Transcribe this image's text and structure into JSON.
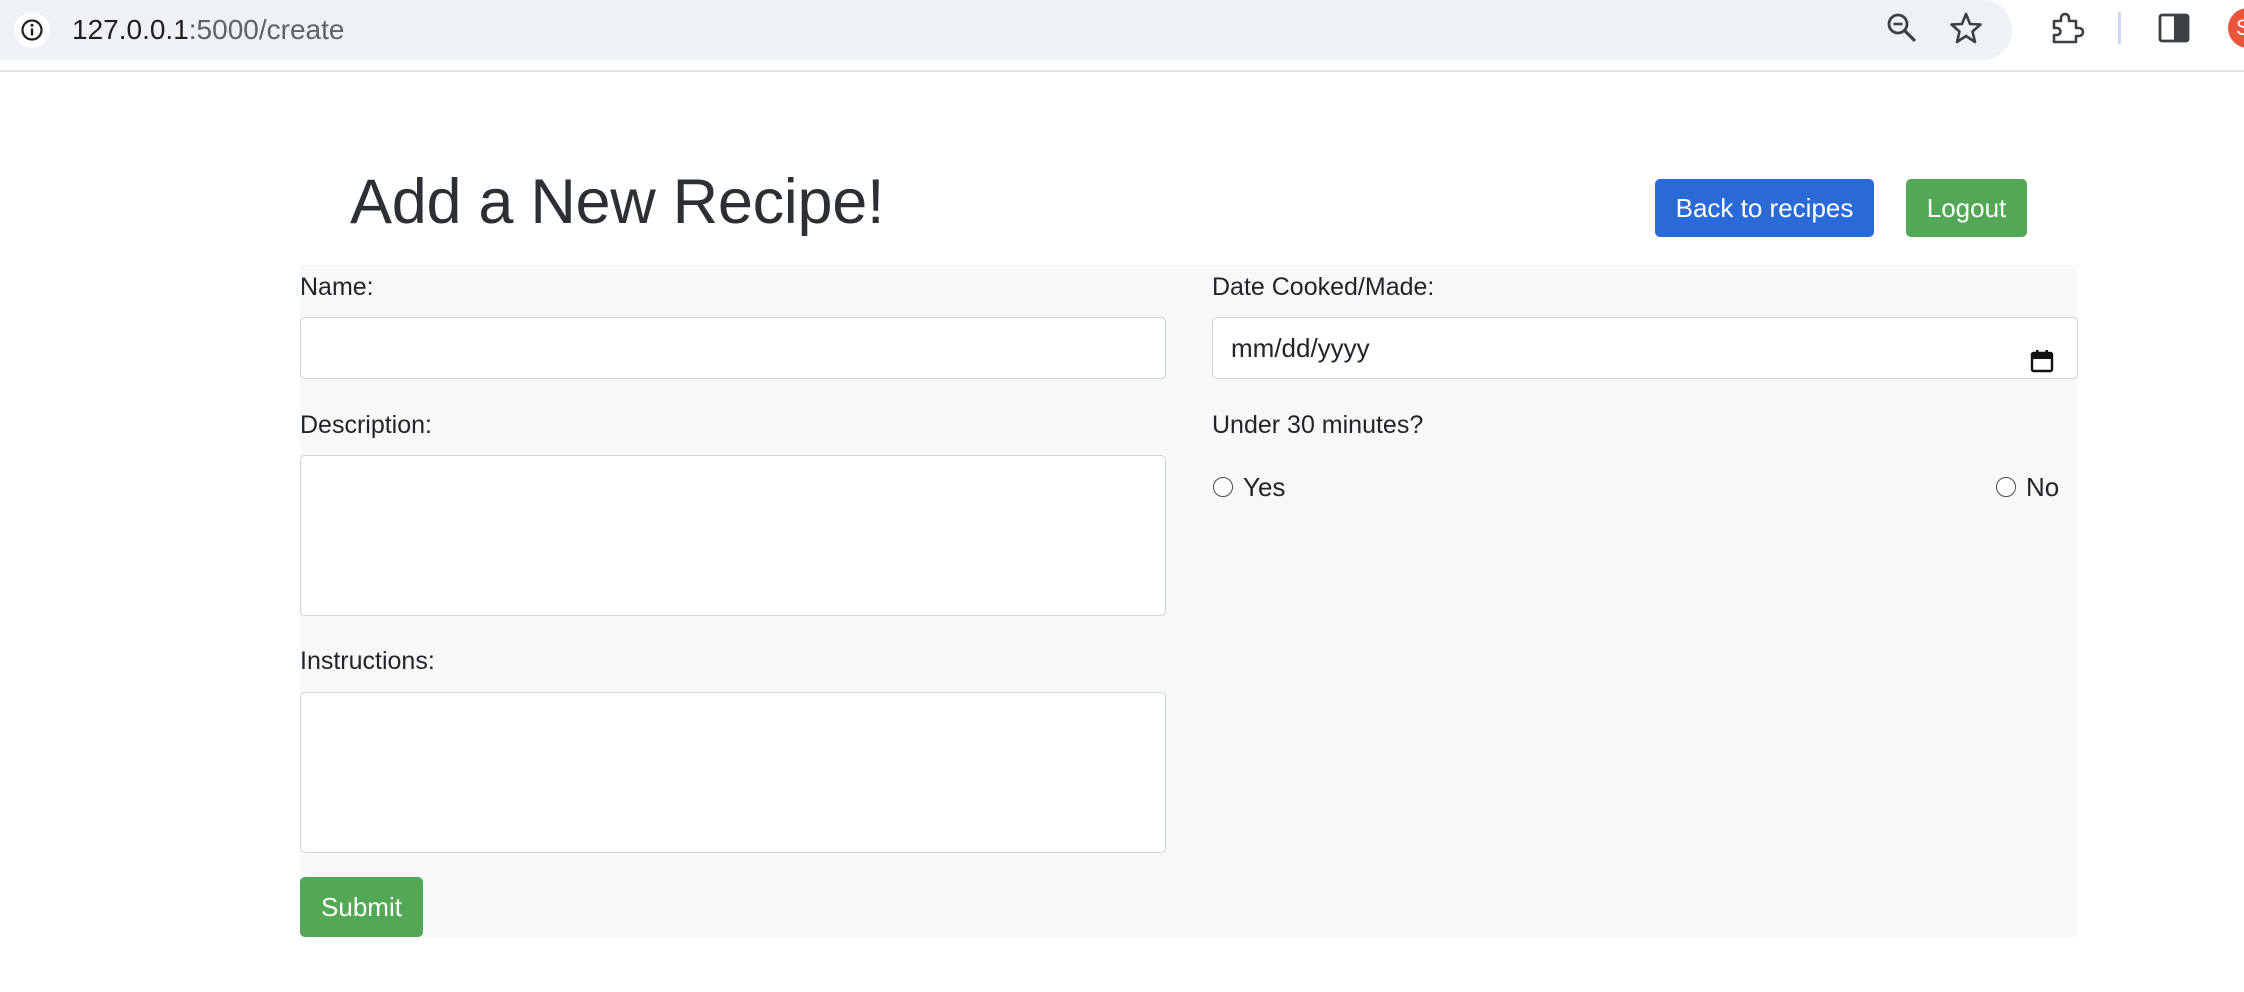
{
  "browser": {
    "url_host": "127.0.0.1",
    "url_path": ":5000/create",
    "profile_initial": "S"
  },
  "header": {
    "title": "Add a New Recipe!",
    "back_label": "Back to recipes",
    "logout_label": "Logout"
  },
  "form": {
    "name_label": "Name:",
    "name_value": "",
    "description_label": "Description:",
    "description_value": "",
    "instructions_label": "Instructions:",
    "instructions_value": "",
    "date_label": "Date Cooked/Made:",
    "date_placeholder": "mm/dd/yyyy",
    "under30_label": "Under 30 minutes?",
    "radio_options": [
      {
        "label": "Yes",
        "checked": false
      },
      {
        "label": "No",
        "checked": false
      }
    ],
    "submit_label": "Submit"
  },
  "colors": {
    "primary_button": "#2a6ad7",
    "success_button": "#52a854",
    "panel_background": "#f7f8fa",
    "omnibox_background": "#eef1f6"
  },
  "icons": [
    "info-icon",
    "zoom-out-icon",
    "star-icon",
    "extensions-icon",
    "side-panel-icon",
    "calendar-icon"
  ]
}
